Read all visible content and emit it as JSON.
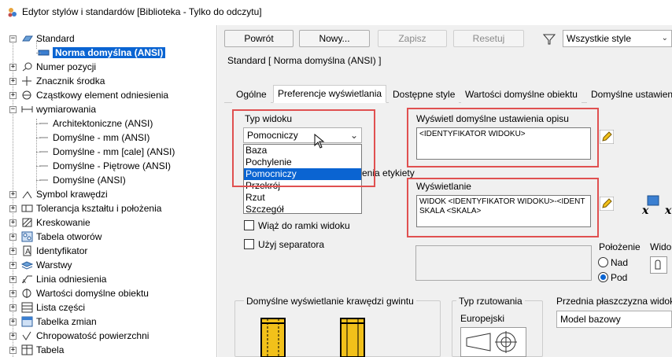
{
  "window": {
    "title": "Edytor stylów i standardów [Biblioteka - Tylko do odczytu]"
  },
  "tree": {
    "root": "Standard",
    "selected": "Norma domyślna (ANSI)",
    "items": [
      "Numer pozycji",
      "Znacznik środka",
      "Cząstkowy element odniesienia",
      "wymiarowania",
      "Architektoniczne (ANSI)",
      "Domyślne - mm (ANSI)",
      "Domyślne - mm [cale] (ANSI)",
      "Domyślne - Piętrowe (ANSI)",
      "Domyślne (ANSI)",
      "Symbol krawędzi",
      "Tolerancja kształtu i położenia",
      "Kreskowanie",
      "Tabela otworów",
      "Identyfikator",
      "Warstwy",
      "Linia odniesienia",
      "Wartości domyślne obiektu",
      "Lista części",
      "Tabelka zmian",
      "Chropowatość powierzchni",
      "Tabela"
    ]
  },
  "toolbar": {
    "back": "Powrót",
    "new": "Nowy...",
    "save": "Zapisz",
    "reset": "Resetuj",
    "filter_value": "Wszystkie style"
  },
  "header": "Standard [ Norma domyślna (ANSI) ]",
  "tabs": [
    "Ogólne",
    "Preferencje wyświetlania",
    "Dostępne style",
    "Wartości domyślne obiektu",
    "Domyślne ustawien"
  ],
  "view_type": {
    "label": "Typ widoku",
    "value": "Pomocniczy",
    "options": [
      "Baza",
      "Pochylenie",
      "Pomocniczy",
      "Przekrój",
      "Rzut",
      "Szczegół"
    ],
    "hidden_label_fragment": "enia etykiety"
  },
  "label_defaults": {
    "label": "Wyświetl domyślne ustawienia opisu",
    "value": "<IDENTYFIKATOR WIDOKU>"
  },
  "display": {
    "label": "Wyświetlanie",
    "line1": "WIDOK <IDENTYFIKATOR WIDOKU>-<IDENT",
    "line2": "SKALA <SKALA>"
  },
  "checkboxes": {
    "bind_to_frame": "Wiąż do ramki widoku",
    "use_separator": "Użyj separatora"
  },
  "position": {
    "label": "Położenie",
    "above": "Nad",
    "below": "Pod",
    "selected": "Pod",
    "visibility_label": "Wido"
  },
  "thread": {
    "label": "Domyślne wyświetlanie krawędzi gwintu"
  },
  "projection": {
    "label": "Typ rzutowania",
    "value": "Europejski"
  },
  "front_plane": {
    "label": "Przednia płaszczyzna widok",
    "value": "Model bazowy"
  }
}
